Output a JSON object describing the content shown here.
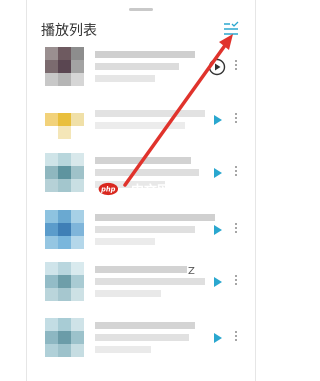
{
  "header": {
    "title": "播放列表",
    "filter_icon": "list-filter-icon"
  },
  "rows": [
    {
      "play_icon": "play-circle-outline-icon",
      "more_icon": "vertical-dots-icon"
    },
    {
      "play_icon": "play-icon",
      "more_icon": "vertical-dots-icon"
    },
    {
      "play_icon": "play-icon",
      "more_icon": "vertical-dots-icon"
    },
    {
      "play_icon": "play-icon",
      "more_icon": "vertical-dots-icon"
    },
    {
      "play_icon": "play-icon",
      "more_icon": "vertical-dots-icon"
    },
    {
      "play_icon": "play-icon",
      "more_icon": "vertical-dots-icon"
    }
  ],
  "watermark": {
    "text": "中文网",
    "logo_text": "php"
  },
  "stray_text": "Z",
  "colors": {
    "accent": "#2aa7cf",
    "annotation_arrow": "#e0332c",
    "watermark": "#d9281f"
  }
}
